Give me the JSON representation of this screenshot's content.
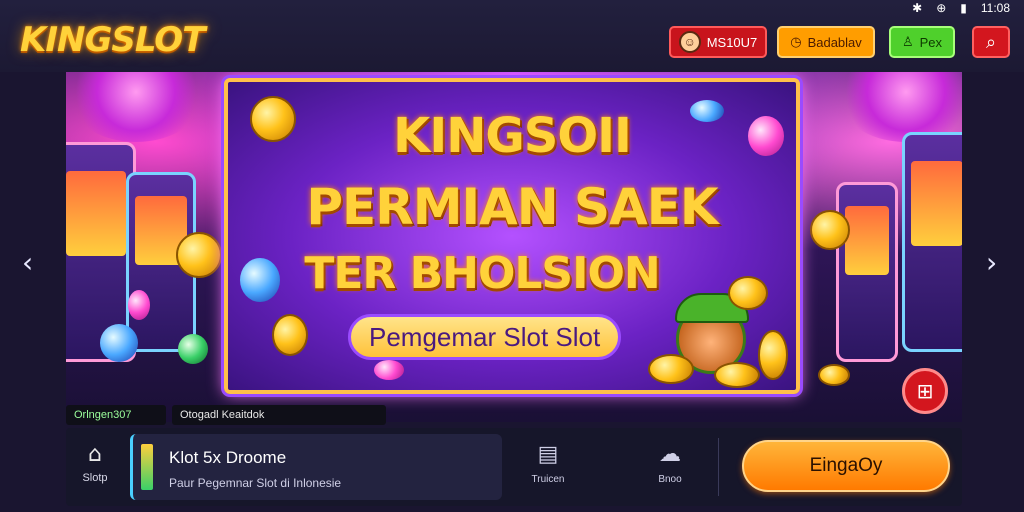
{
  "brand": {
    "logo_text": "KINGSLOT",
    "accent": "#ffd23a"
  },
  "status_bar": {
    "icons": [
      "signal-icon",
      "wifi-icon",
      "battery-icon"
    ],
    "time": "11:08"
  },
  "header": {
    "user_button": {
      "label": "MS10U7",
      "color": "#c8141c"
    },
    "orange_button": {
      "label": "Badablav",
      "color": "#ff9d00"
    },
    "green_button": {
      "label": "Pex",
      "color": "#4fd02c"
    },
    "search_icon": "search-icon"
  },
  "banner": {
    "headline_lines": [
      "KINGSOII",
      "PERMIAN SAEK",
      "TER BHOLSION"
    ],
    "subtitle": "Pemgemar Slot Slot",
    "prev_icon": "chevron-left-icon",
    "next_icon": "chevron-right-icon",
    "gift_icon": "gift-icon"
  },
  "captions": {
    "left": "Orlngen307",
    "right": "Otogadl Keaitdok"
  },
  "bottom_bar": {
    "home": {
      "label": "Slotp",
      "icon": "home-icon"
    },
    "card": {
      "title": "Klot 5x Droome",
      "subtitle": "Paur Pegemnar Slot di Inlonesie"
    },
    "nav_a": {
      "label": "Truicen",
      "icon": "ticket-icon"
    },
    "nav_b": {
      "label": "Bnoo",
      "icon": "chat-icon"
    },
    "cta": {
      "label": "EingaOy",
      "color": "#ff7a00"
    }
  }
}
